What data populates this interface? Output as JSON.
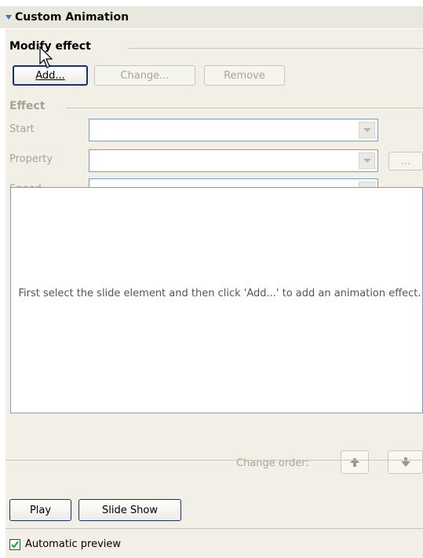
{
  "panel": {
    "title": "Custom Animation"
  },
  "modify": {
    "title": "Modify effect",
    "add_label": "Add...",
    "change_label": "Change...",
    "remove_label": "Remove"
  },
  "effect": {
    "title": "Effect",
    "start_label": "Start",
    "property_label": "Property",
    "speed_label": "Speed",
    "more_label": "..."
  },
  "list": {
    "message": "First select the slide element and then click 'Add...' to add an animation effect."
  },
  "order": {
    "label": "Change order:"
  },
  "actions": {
    "play_label": "Play",
    "slideshow_label": "Slide Show"
  },
  "preview": {
    "label": "Automatic preview",
    "checked": true
  },
  "colors": {
    "accent": "#1a2f6b",
    "panel_bg": "#f1efe6",
    "disabled": "#a7a597"
  }
}
